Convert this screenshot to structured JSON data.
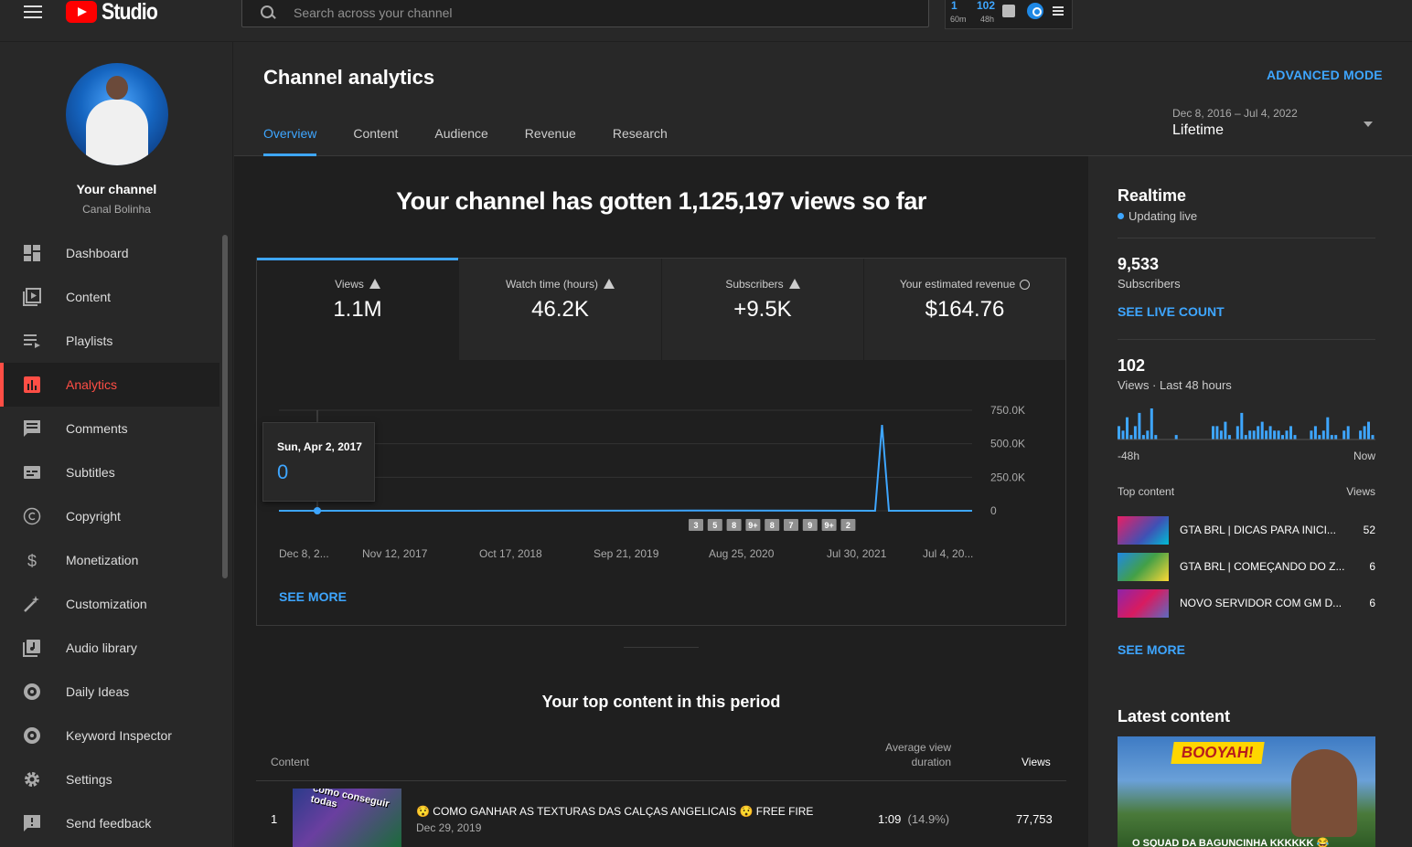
{
  "app": {
    "title": "Studio"
  },
  "search": {
    "placeholder": "Search across your channel"
  },
  "ext": {
    "realtime_count": "1",
    "realtime_label": "60m",
    "views_count": "102",
    "views_label": "48h"
  },
  "channel": {
    "title": "Your channel",
    "name": "Canal Bolinha"
  },
  "sidebar": {
    "items": [
      {
        "label": "Dashboard",
        "icon": "dashboard-icon"
      },
      {
        "label": "Content",
        "icon": "content-icon"
      },
      {
        "label": "Playlists",
        "icon": "playlists-icon"
      },
      {
        "label": "Analytics",
        "icon": "analytics-icon",
        "active": true
      },
      {
        "label": "Comments",
        "icon": "comments-icon"
      },
      {
        "label": "Subtitles",
        "icon": "subtitles-icon"
      },
      {
        "label": "Copyright",
        "icon": "copyright-icon"
      },
      {
        "label": "Monetization",
        "icon": "monetization-icon"
      },
      {
        "label": "Customization",
        "icon": "customization-icon"
      },
      {
        "label": "Audio library",
        "icon": "audio-library-icon"
      },
      {
        "label": "Daily Ideas",
        "icon": "daily-ideas-icon"
      },
      {
        "label": "Keyword Inspector",
        "icon": "keyword-inspector-icon"
      },
      {
        "label": "Settings",
        "icon": "settings-icon"
      },
      {
        "label": "Send feedback",
        "icon": "feedback-icon"
      }
    ]
  },
  "header": {
    "title": "Channel analytics",
    "advanced_mode": "ADVANCED MODE",
    "tabs": [
      "Overview",
      "Content",
      "Audience",
      "Revenue",
      "Research"
    ],
    "date_range": "Dec 8, 2016 – Jul 4, 2022",
    "date_value": "Lifetime"
  },
  "overview": {
    "headline": "Your channel has gotten 1,125,197 views so far",
    "metrics": [
      {
        "label": "Views",
        "value": "1.1M",
        "icon": "warning-icon"
      },
      {
        "label": "Watch time (hours)",
        "value": "46.2K",
        "icon": "warning-icon"
      },
      {
        "label": "Subscribers",
        "value": "+9.5K",
        "icon": "warning-icon"
      },
      {
        "label": "Your estimated revenue",
        "value": "$164.76",
        "icon": "clock-icon"
      }
    ],
    "see_more": "SEE MORE",
    "tooltip": {
      "date": "Sun, Apr 2, 2017",
      "value": "0"
    }
  },
  "chart_data": {
    "type": "line",
    "x_tick_labels": [
      "Dec 8, 2...",
      "Nov 12, 2017",
      "Oct 17, 2018",
      "Sep 21, 2019",
      "Aug 25, 2020",
      "Jul 30, 2021",
      "Jul 4, 20..."
    ],
    "y_tick_labels": [
      "750.0K",
      "500.0K",
      "250.0K",
      "0"
    ],
    "ylim": [
      0,
      750000
    ],
    "series": [
      {
        "x": [
          0,
          0.06,
          0.5,
          0.6,
          0.86,
          0.87,
          0.88,
          1
        ],
        "y": [
          0,
          0,
          500,
          2000,
          0,
          640000,
          0,
          0
        ]
      }
    ],
    "markers": [
      "3",
      "5",
      "8",
      "9+",
      "8",
      "7",
      "9",
      "9+",
      "2"
    ],
    "color": "#3ea6ff"
  },
  "top_content": {
    "title": "Your top content in this period",
    "col_content": "Content",
    "col_avg_line1": "Average view",
    "col_avg_line2": "duration",
    "col_views": "Views",
    "rows": [
      {
        "num": "1",
        "thumb_text": "como conseguir todas",
        "title": "😯 COMO GANHAR AS TEXTURAS DAS CALÇAS ANGELICAIS 😯 FREE FIRE",
        "date": "Dec 29, 2019",
        "avg": "1:09",
        "avg_pct": "(14.9%)",
        "views": "77,753"
      }
    ]
  },
  "realtime": {
    "title": "Realtime",
    "live": "Updating live",
    "subs_value": "9,533",
    "subs_label": "Subscribers",
    "see_live": "SEE LIVE COUNT",
    "views_value": "102",
    "views_label": "Views · Last 48 hours",
    "bars": [
      3,
      2,
      5,
      1,
      3,
      6,
      1,
      2,
      7,
      1,
      0,
      0,
      0,
      0,
      1,
      0,
      0,
      0,
      0,
      0,
      0,
      0,
      0,
      3,
      3,
      2,
      4,
      1,
      0,
      3,
      6,
      1,
      2,
      2,
      3,
      4,
      2,
      3,
      2,
      2,
      1,
      2,
      3,
      1,
      0,
      0,
      0,
      2,
      3,
      1,
      2,
      5,
      1,
      1,
      0,
      2,
      3,
      0,
      0,
      2,
      3,
      4,
      1
    ],
    "axis_left": "-48h",
    "axis_right": "Now",
    "top_label": "Top content",
    "views_col": "Views",
    "items": [
      {
        "title": "GTA BRL | DICAS PARA INICI...",
        "views": "52"
      },
      {
        "title": "GTA BRL | COMEÇANDO DO Z...",
        "views": "6"
      },
      {
        "title": "NOVO SERVIDOR COM GM D...",
        "views": "6"
      }
    ],
    "see_more": "SEE MORE"
  },
  "latest": {
    "title": "Latest content",
    "thumb_banner": "BOOYAH!",
    "thumb_caption": "O SQUAD DA BAGUNCINHA KKKKKK 😂"
  }
}
